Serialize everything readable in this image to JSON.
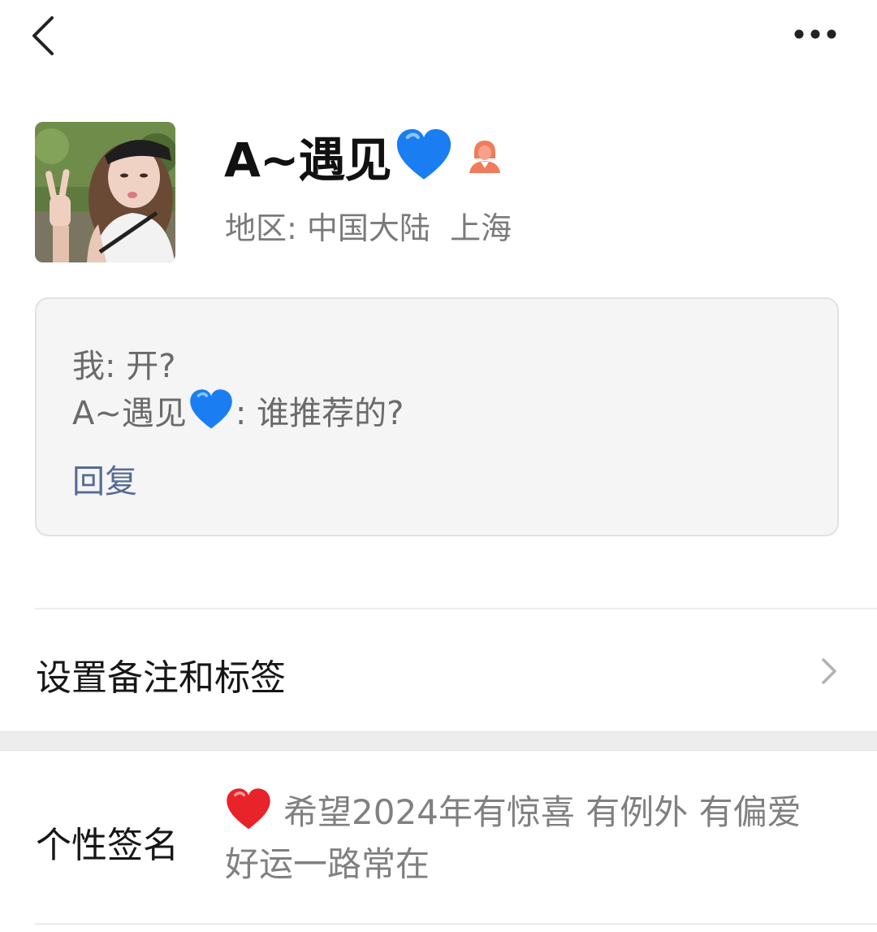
{
  "profile": {
    "name": "A~遇见",
    "name_emoji": "blue-heart",
    "gender": "female",
    "region_label": "地区:",
    "region_value": "中国大陆  上海"
  },
  "message": {
    "line1": "我: 开?",
    "line2_sender": "A~遇见",
    "line2_text": ": 谁推荐的?",
    "reply_label": "回复"
  },
  "settings": {
    "remark_label": "设置备注和标签"
  },
  "signature": {
    "label": "个性签名",
    "text": "希望2024年有惊喜 有例外 有偏爱 好运一路常在"
  },
  "colors": {
    "link": "#576b95",
    "gender_icon": "#f07c5c",
    "blue_heart": "#1a7ef2",
    "red_heart": "#e8242a"
  }
}
